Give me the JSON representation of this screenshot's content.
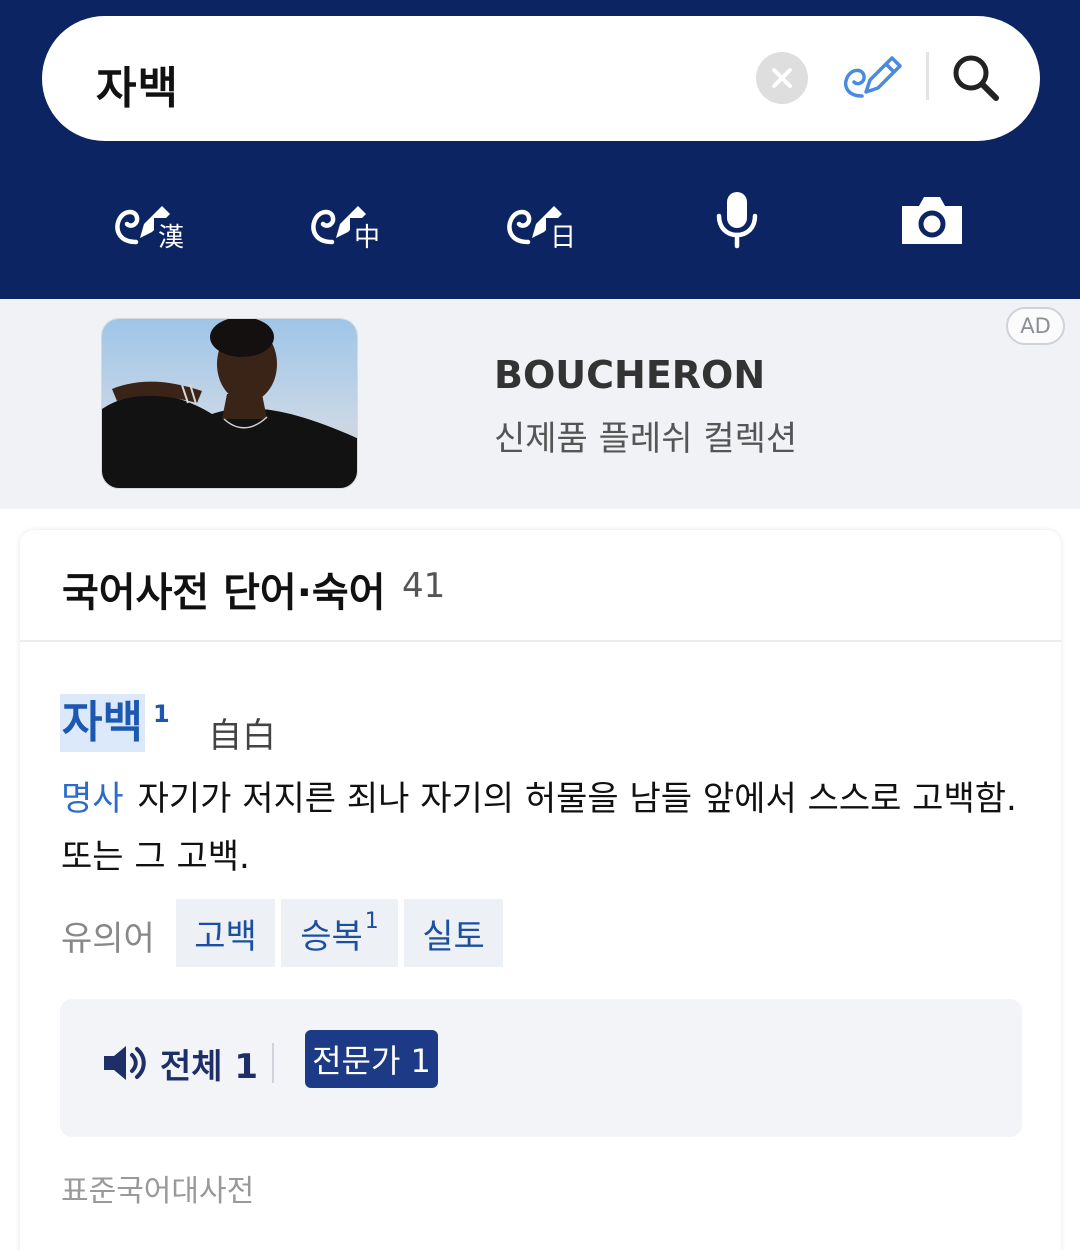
{
  "search": {
    "query": "자백"
  },
  "tools": [
    {
      "icon": "handwriting-hanja-icon",
      "glyph": "漢"
    },
    {
      "icon": "handwriting-chinese-icon",
      "glyph": "中"
    },
    {
      "icon": "handwriting-japanese-icon",
      "glyph": "日"
    },
    {
      "icon": "microphone-icon"
    },
    {
      "icon": "camera-icon"
    }
  ],
  "ad": {
    "brand": "BOUCHERON",
    "copy": "신제품 플레쉬 컬렉션",
    "badge": "AD"
  },
  "result": {
    "section_title": "국어사전 단어·숙어",
    "section_count": "41",
    "entry": {
      "word": "자백",
      "superscript": "1",
      "hanja": "自白",
      "pos": "명사",
      "definition": "자기가 저지른 죄나 자기의 허물을 남들 앞에서 스스로 고백함. 또는 그 고백."
    },
    "synonym_label": "유의어",
    "synonyms": [
      {
        "word": "고백",
        "sup": ""
      },
      {
        "word": "승복",
        "sup": "1"
      },
      {
        "word": "실토",
        "sup": ""
      }
    ],
    "pronunciation": {
      "all_label": "전체 1",
      "expert_label": "전문가 1"
    },
    "source": "표준국어대사전"
  },
  "colors": {
    "header_bg": "#0d2462",
    "link_blue": "#1c57b0",
    "chip_bg": "#edf0f4",
    "expert_btn": "#1c3a86"
  }
}
